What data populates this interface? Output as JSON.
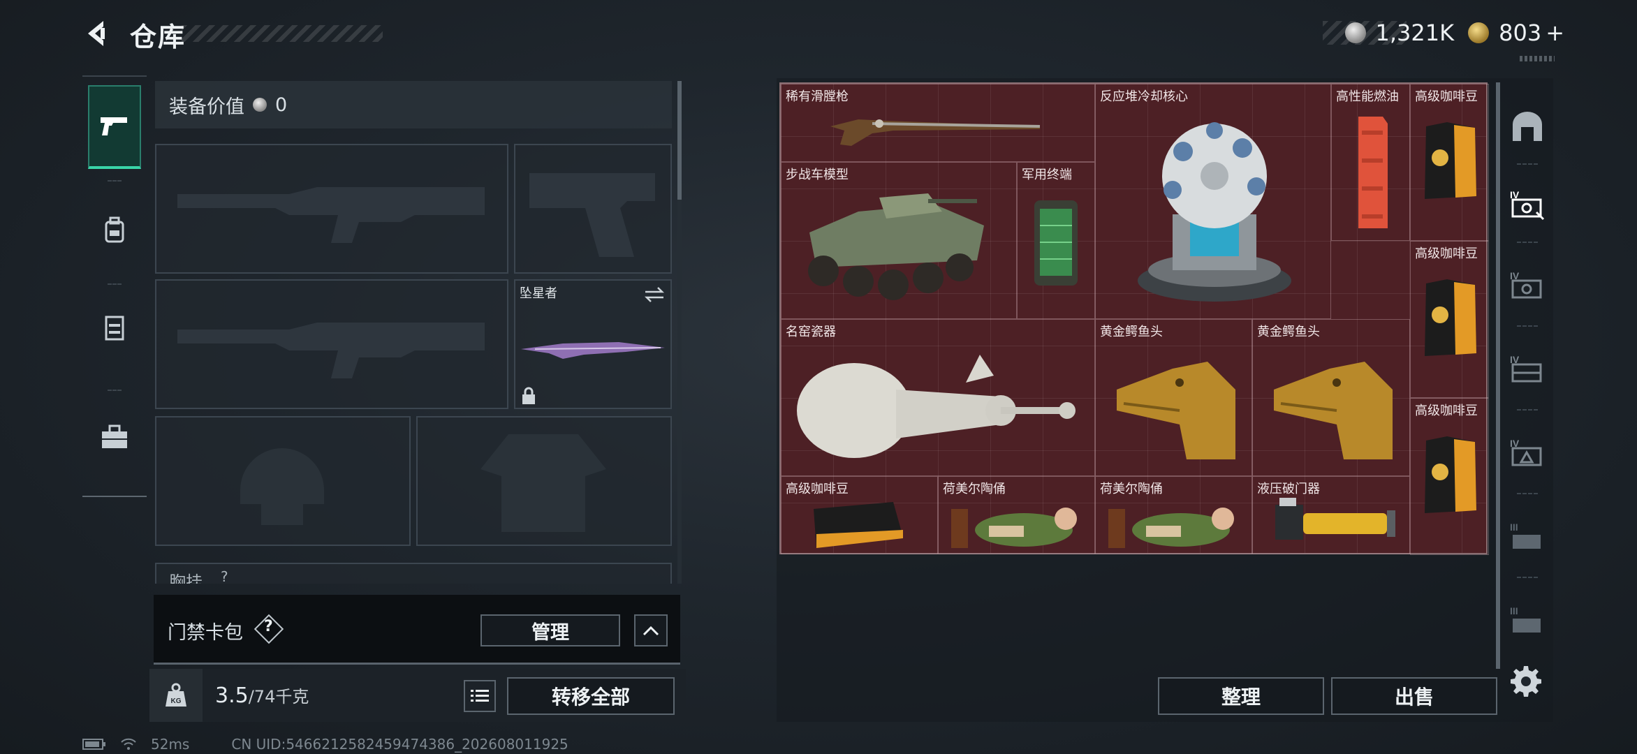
{
  "header": {
    "title": "仓库",
    "currency_silver": "1,321K",
    "currency_gold": "803",
    "plus": "+"
  },
  "left_tabs": [
    "pistol-icon",
    "backpack-icon",
    "vest-icon",
    "toolbox-icon"
  ],
  "equipment": {
    "value_label": "装备价值",
    "value": "0",
    "melee_name": "坠星者",
    "chest_label": "胸挂",
    "chest_help": "?"
  },
  "keycard": {
    "label": "门禁卡包",
    "help": "?",
    "manage": "管理"
  },
  "weight": {
    "icon_text": "KG",
    "current": "3.5",
    "max": "/74千克",
    "transfer_all": "转移全部"
  },
  "stash_items": [
    {
      "name": "稀有滑膛枪",
      "icon": "musket-icon"
    },
    {
      "name": "反应堆冷却核心",
      "icon": "reactor-core-icon"
    },
    {
      "name": "高性能燃油",
      "icon": "fuel-can-icon"
    },
    {
      "name": "高级咖啡豆",
      "icon": "coffee-bag-icon"
    },
    {
      "name": "步战车模型",
      "icon": "ifv-model-icon"
    },
    {
      "name": "军用终端",
      "icon": "military-terminal-icon"
    },
    {
      "name": "高级咖啡豆",
      "icon": "coffee-bag-icon"
    },
    {
      "name": "名窑瓷器",
      "icon": "porcelain-vase-icon"
    },
    {
      "name": "黄金鳄鱼头",
      "icon": "gold-croc-head-icon"
    },
    {
      "name": "黄金鳄鱼头",
      "icon": "gold-croc-head-icon"
    },
    {
      "name": "高级咖啡豆",
      "icon": "coffee-bag-icon"
    },
    {
      "name": "高级咖啡豆",
      "icon": "coffee-bag-icon"
    },
    {
      "name": "荷美尔陶俑",
      "icon": "figurine-icon"
    },
    {
      "name": "荷美尔陶俑",
      "icon": "figurine-icon"
    },
    {
      "name": "液压破门器",
      "icon": "hydraulic-breacher-icon"
    }
  ],
  "actions": {
    "sort": "整理",
    "sell": "出售"
  },
  "right_icons": [
    "home-icon",
    "storage-iv-icon",
    "storage-iv-2-icon",
    "storage-iv-3-icon",
    "storage-iv-4-icon",
    "storage-iii-icon",
    "storage-iii-2-icon",
    "settings-gear-icon"
  ],
  "status": {
    "ping": "52ms",
    "uid": "CN UID:5466212582459474386_202608011925"
  },
  "colors": {
    "stash_bg": "#4d2025",
    "accent_green": "#39d4a8"
  }
}
